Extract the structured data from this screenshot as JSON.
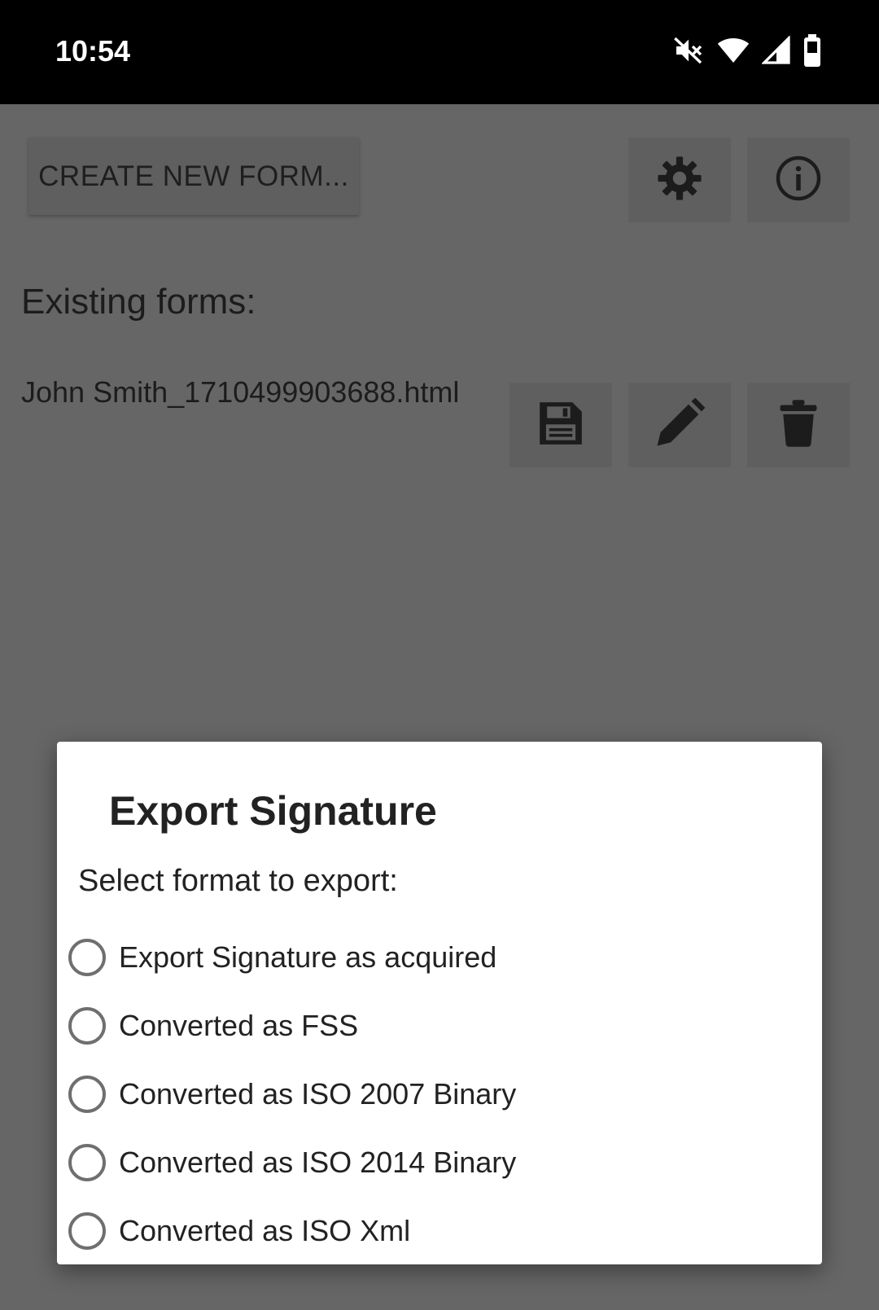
{
  "status_bar": {
    "time": "10:54",
    "icons": [
      "mute-icon",
      "wifi-icon",
      "signal-icon",
      "battery-icon"
    ]
  },
  "toolbar": {
    "create_label": "CREATE NEW FORM...",
    "settings_icon": "gear-icon",
    "info_icon": "info-icon"
  },
  "main": {
    "section_label": "Existing forms:",
    "forms": [
      {
        "name": "John Smith_1710499903688.html",
        "actions": [
          "save-icon",
          "edit-icon",
          "delete-icon"
        ]
      }
    ]
  },
  "dialog": {
    "title": "Export Signature",
    "message": "Select format to export:",
    "options": [
      {
        "label": "Export Signature as acquired",
        "selected": false
      },
      {
        "label": "Converted as FSS",
        "selected": false
      },
      {
        "label": "Converted as ISO 2007 Binary",
        "selected": false
      },
      {
        "label": "Converted as ISO 2014 Binary",
        "selected": false
      },
      {
        "label": "Converted as ISO Xml",
        "selected": false
      }
    ]
  },
  "colors": {
    "scrim_background": "#666666",
    "button_background": "#5f5f5f",
    "dialog_background": "#ffffff",
    "status_bar": "#000000"
  }
}
